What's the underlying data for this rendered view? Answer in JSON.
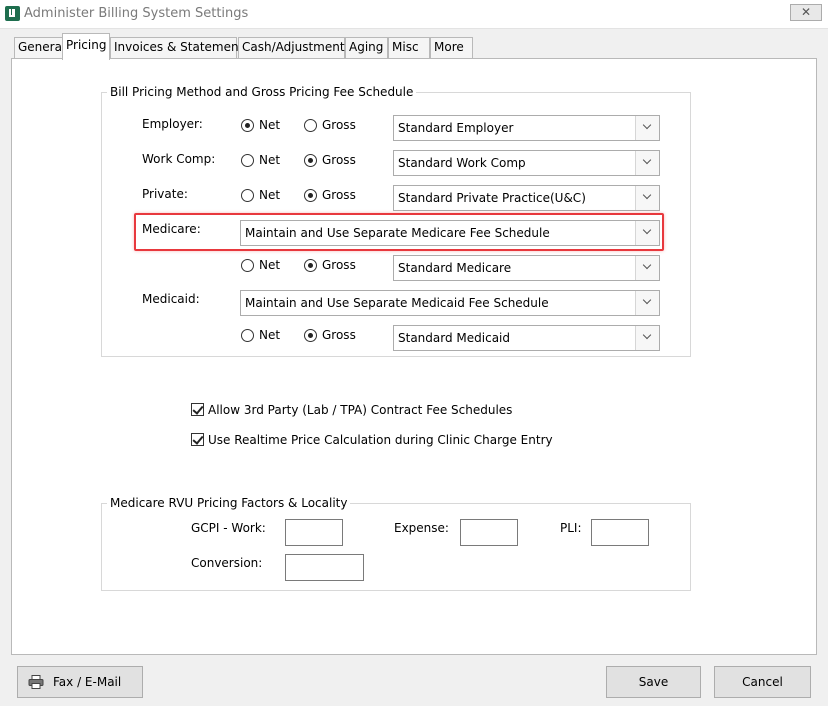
{
  "window": {
    "title": "Administer Billing System Settings",
    "close_label": "⊠"
  },
  "tabs": [
    {
      "label": "General",
      "active": false
    },
    {
      "label": "Pricing",
      "active": true
    },
    {
      "label": "Invoices & Statements",
      "active": false
    },
    {
      "label": "Cash/Adjustments",
      "active": false
    },
    {
      "label": "Aging",
      "active": false
    },
    {
      "label": "Misc",
      "active": false
    },
    {
      "label": "More",
      "active": false
    }
  ],
  "pricing_group": {
    "title": "Bill Pricing Method and Gross Pricing Fee Schedule",
    "net_label": "Net",
    "gross_label": "Gross",
    "rows": {
      "employer": {
        "label": "Employer:",
        "selected": "Net",
        "fee_schedule": "Standard Employer"
      },
      "work_comp": {
        "label": "Work Comp:",
        "selected": "Gross",
        "fee_schedule": "Standard Work Comp"
      },
      "private": {
        "label": "Private:",
        "selected": "Gross",
        "fee_schedule": "Standard Private Practice(U&C)"
      },
      "medicare": {
        "label": "Medicare:",
        "option": "Maintain and Use Separate Medicare Fee Schedule",
        "selected": "Gross",
        "fee_schedule": "Standard Medicare"
      },
      "medicaid": {
        "label": "Medicaid:",
        "option": "Maintain and Use Separate Medicaid Fee Schedule",
        "selected": "Gross",
        "fee_schedule": "Standard Medicaid"
      }
    },
    "highlight_color": "#e8383d"
  },
  "options": {
    "allow_3rd_party": {
      "label": "Allow 3rd Party (Lab / TPA) Contract Fee Schedules",
      "checked": true
    },
    "realtime_price": {
      "label": "Use Realtime Price Calculation during Clinic Charge Entry",
      "checked": true
    }
  },
  "rvu_group": {
    "title": "Medicare RVU Pricing Factors & Locality",
    "gcpi_work_label": "GCPI - Work:",
    "gcpi_work_value": "",
    "expense_label": "Expense:",
    "expense_value": "",
    "pli_label": "PLI:",
    "pli_value": "",
    "conversion_label": "Conversion:",
    "conversion_value": ""
  },
  "buttons": {
    "fax_email": "Fax / E-Mail",
    "save": "Save",
    "cancel": "Cancel"
  },
  "icons": {
    "app": "app-logo-icon",
    "printer": "printer-icon",
    "dropdown": "chevron-down-icon"
  }
}
